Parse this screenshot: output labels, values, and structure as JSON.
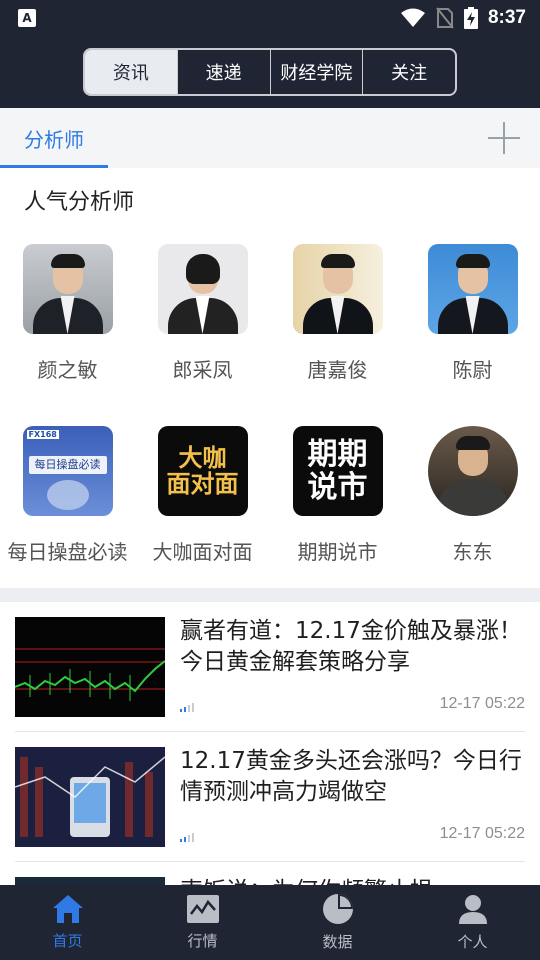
{
  "statusbar": {
    "time": "8:37",
    "app_badge": "A"
  },
  "header": {
    "tabs": [
      {
        "label": "资讯",
        "active": true
      },
      {
        "label": "速递",
        "active": false
      },
      {
        "label": "财经学院",
        "active": false
      },
      {
        "label": "关注",
        "active": false
      }
    ]
  },
  "subbar": {
    "active_tab": "分析师"
  },
  "analysts": {
    "section_title": "人气分析师",
    "items": [
      {
        "name": "颜之敏"
      },
      {
        "name": "郎采凤"
      },
      {
        "name": "唐嘉俊"
      },
      {
        "name": "陈尉"
      },
      {
        "name": "每日操盘必读",
        "tile_text": "每日操盘必读",
        "tile_badge": "FX168"
      },
      {
        "name": "大咖面对面",
        "tile_lines": [
          "大咖",
          "面对面"
        ]
      },
      {
        "name": "期期说市",
        "tile_lines": [
          "期期",
          "说市"
        ]
      },
      {
        "name": "东东"
      }
    ]
  },
  "news": [
    {
      "title": "赢者有道：12.17金价触及暴涨！今日黄金解套策略分享",
      "time": "12-17 05:22"
    },
    {
      "title": "12.17黄金多头还会涨吗？今日行情预测冲高力竭做空",
      "time": "12-17 05:22"
    },
    {
      "title": "索饭说：为何你频繁止损",
      "time": ""
    }
  ],
  "bottomnav": [
    {
      "label": "首页",
      "icon": "home-icon",
      "active": true
    },
    {
      "label": "行情",
      "icon": "chart-icon",
      "active": false
    },
    {
      "label": "数据",
      "icon": "pie-icon",
      "active": false
    },
    {
      "label": "个人",
      "icon": "person-icon",
      "active": false
    }
  ],
  "colors": {
    "accent": "#2f7ae5",
    "dark": "#1f2532"
  }
}
